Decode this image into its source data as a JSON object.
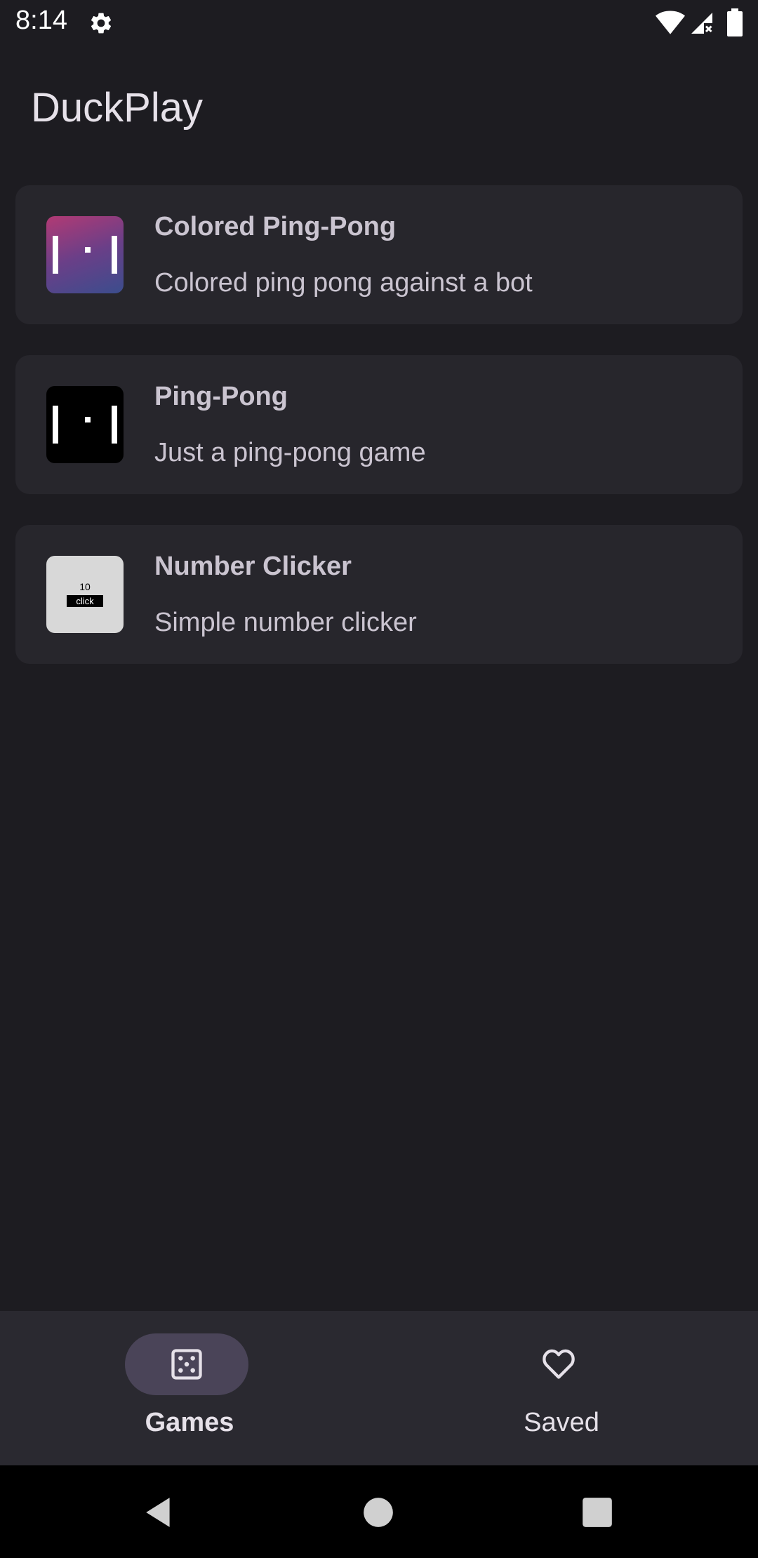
{
  "status_bar": {
    "time": "8:14",
    "icons": [
      "gear-icon",
      "wifi-icon",
      "signal-icon",
      "battery-icon"
    ]
  },
  "header": {
    "title": "DuckPlay"
  },
  "games": [
    {
      "title": "Colored Ping-Pong",
      "description": "Colored ping pong against a bot",
      "thumbnail": "colored-ping-pong-thumbnail"
    },
    {
      "title": "Ping-Pong",
      "description": "Just a ping-pong game",
      "thumbnail": "ping-pong-thumbnail"
    },
    {
      "title": "Number Clicker",
      "description": "Simple number clicker",
      "thumbnail": "number-clicker-thumbnail",
      "thumb_number": "10",
      "thumb_button": "click"
    }
  ],
  "bottom_nav": {
    "items": [
      {
        "label": "Games",
        "icon": "dice-icon",
        "active": true
      },
      {
        "label": "Saved",
        "icon": "heart-icon",
        "active": false
      }
    ]
  },
  "system_nav": {
    "icons": [
      "back-icon",
      "home-icon",
      "recents-icon"
    ]
  },
  "colors": {
    "background": "#1d1c21",
    "card": "#27262c",
    "nav_bar": "#2a2930",
    "active_pill": "#4a4458",
    "text": "#e6e1e9",
    "secondary_text": "#cac4d0"
  }
}
